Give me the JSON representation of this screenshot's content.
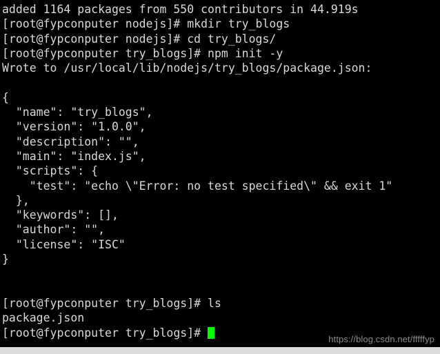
{
  "terminal": {
    "prompt_user": "root",
    "prompt_host": "fypconputer",
    "cursor_color": "#00ff00",
    "text_color": "#d8d8d8",
    "background_color": "#000000",
    "lines": [
      {
        "id": "npm-install-summary",
        "text": "added 1164 packages from 550 contributors in 44.919s"
      },
      {
        "id": "cmd-mkdir",
        "text": "[root@fypconputer nodejs]# mkdir try_blogs"
      },
      {
        "id": "cmd-cd",
        "text": "[root@fypconputer nodejs]# cd try_blogs/"
      },
      {
        "id": "cmd-npm-init",
        "text": "[root@fypconputer try_blogs]# npm init -y"
      },
      {
        "id": "wrote-to-path",
        "text": "Wrote to /usr/local/lib/nodejs/try_blogs/package.json:"
      },
      {
        "id": "blank-1",
        "text": ""
      },
      {
        "id": "json-open-brace",
        "text": "{"
      },
      {
        "id": "json-name",
        "text": "  \"name\": \"try_blogs\","
      },
      {
        "id": "json-version",
        "text": "  \"version\": \"1.0.0\","
      },
      {
        "id": "json-description",
        "text": "  \"description\": \"\","
      },
      {
        "id": "json-main",
        "text": "  \"main\": \"index.js\","
      },
      {
        "id": "json-scripts-open",
        "text": "  \"scripts\": {"
      },
      {
        "id": "json-scripts-test",
        "text": "    \"test\": \"echo \\\"Error: no test specified\\\" && exit 1\""
      },
      {
        "id": "json-scripts-close",
        "text": "  },"
      },
      {
        "id": "json-keywords",
        "text": "  \"keywords\": [],"
      },
      {
        "id": "json-author",
        "text": "  \"author\": \"\","
      },
      {
        "id": "json-license",
        "text": "  \"license\": \"ISC\""
      },
      {
        "id": "json-close-brace",
        "text": "}"
      },
      {
        "id": "blank-2",
        "text": ""
      },
      {
        "id": "blank-3",
        "text": ""
      },
      {
        "id": "cmd-ls",
        "text": "[root@fypconputer try_blogs]# ls"
      },
      {
        "id": "ls-output",
        "text": "package.json"
      }
    ],
    "active_prompt": "[root@fypconputer try_blogs]# "
  },
  "watermark": {
    "text": "https://blog.csdn.net/fffffyp"
  }
}
